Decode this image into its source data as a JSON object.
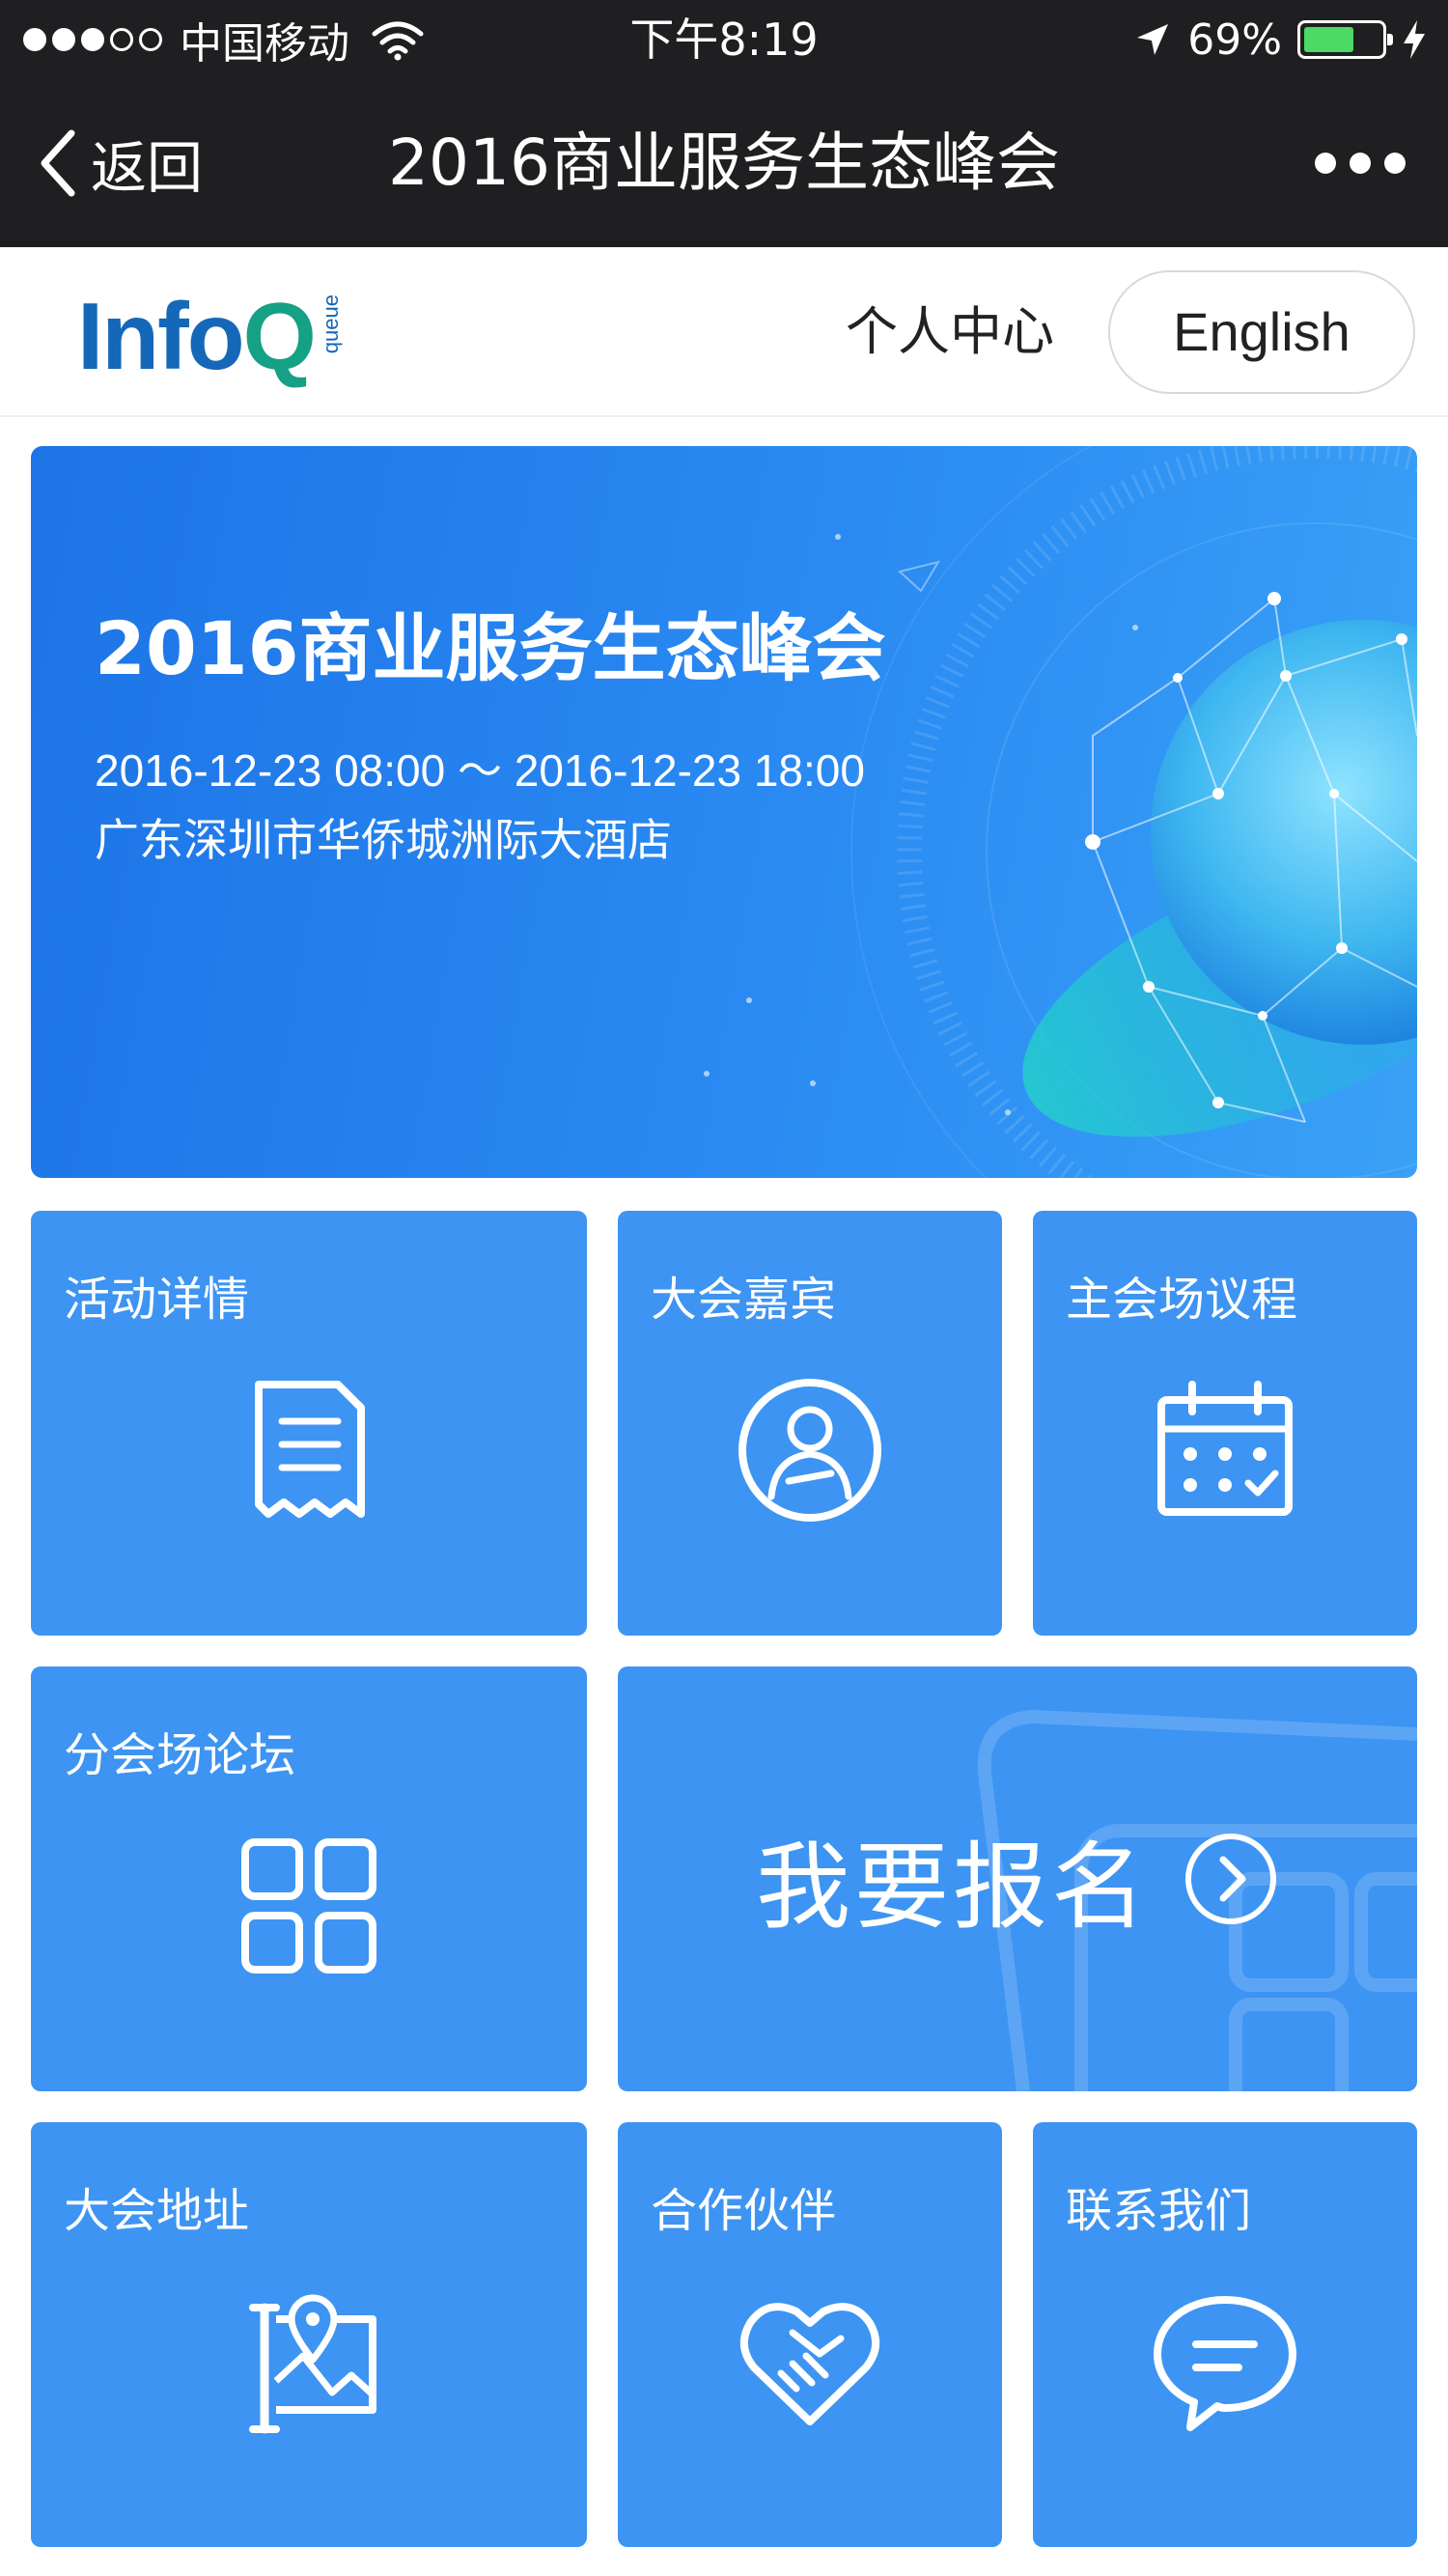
{
  "status_bar": {
    "carrier": "中国移动",
    "time": "下午8:19",
    "battery": "69%",
    "battery_level": 0.69,
    "signal_bars_filled": 3,
    "signal_bars_total": 5,
    "icons": [
      "wifi-icon",
      "location-arrow-icon",
      "battery-icon",
      "charging-bolt-icon"
    ]
  },
  "nav": {
    "back_label": "返回",
    "title": "2016商业服务生态峰会",
    "more_icon": "more-dots-icon"
  },
  "header": {
    "logo_main": "Info",
    "logo_q": "Q",
    "logo_tag": "queue",
    "user_center": "个人中心",
    "language_button": "English"
  },
  "banner": {
    "title": "2016商业服务生态峰会",
    "time": "2016-12-23 08:00 ～ 2016-12-23 18:00",
    "address": "广东深圳市华侨城洲际大酒店"
  },
  "tiles": [
    {
      "label": "活动详情",
      "icon": "document-icon"
    },
    {
      "label": "大会嘉宾",
      "icon": "guest-icon"
    },
    {
      "label": "主会场议程",
      "icon": "calendar-icon"
    },
    {
      "label": "分会场论坛",
      "icon": "grid-icon"
    },
    {
      "label": "大会地址",
      "icon": "map-pin-icon"
    },
    {
      "label": "合作伙伴",
      "icon": "handshake-icon"
    },
    {
      "label": "联系我们",
      "icon": "chat-bubble-icon"
    }
  ],
  "signup": {
    "label": "我要报名",
    "icon": "arrow-circle-right-icon"
  },
  "colors": {
    "bar_bg": "#1f1f21",
    "tile_blue": "#3d94f2",
    "banner_blue": "#1d74e6",
    "logo_blue": "#1568b8",
    "logo_green": "#16a085",
    "battery_green": "#4cd964"
  }
}
